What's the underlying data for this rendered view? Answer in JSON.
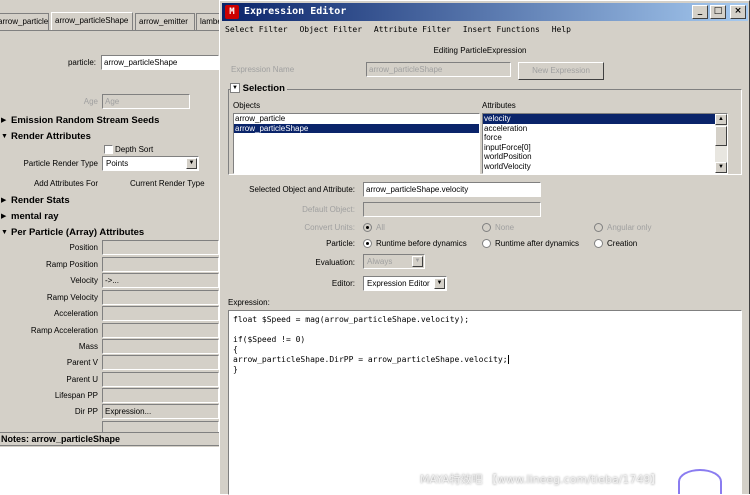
{
  "attr_editor": {
    "tabs": [
      "arrow_particle",
      "arrow_particleShape",
      "arrow_emitter",
      "lambe"
    ],
    "particle_label": "particle:",
    "particle_value": "arrow_particleShape",
    "age_label": "Age",
    "age_value": "Age",
    "sections": {
      "emission": "Emission Random Stream Seeds",
      "render": "Render Attributes",
      "render_stats": "Render Stats",
      "mental_ray": "mental ray",
      "per_particle": "Per Particle (Array) Attributes"
    },
    "depth_sort": "Depth Sort",
    "particle_render_type_label": "Particle Render Type",
    "particle_render_type_value": "Points",
    "add_attributes_label": "Add Attributes For",
    "current_render_type": "Current Render Type",
    "per_particle_attrs": [
      {
        "label": "Position",
        "value": ""
      },
      {
        "label": "Ramp Position",
        "value": ""
      },
      {
        "label": "Velocity",
        "value": "->..."
      },
      {
        "label": "Ramp Velocity",
        "value": ""
      },
      {
        "label": "Acceleration",
        "value": ""
      },
      {
        "label": "Ramp Acceleration",
        "value": ""
      },
      {
        "label": "Mass",
        "value": ""
      },
      {
        "label": "Parent V",
        "value": ""
      },
      {
        "label": "Parent U",
        "value": ""
      },
      {
        "label": "Lifespan PP",
        "value": ""
      },
      {
        "label": "Dir PP",
        "value": "Expression..."
      }
    ],
    "notes": "Notes:  arrow_particleShape"
  },
  "window": {
    "title": "Expression Editor",
    "title_buttons": [
      "_",
      "□",
      "×"
    ],
    "menu": [
      "Select Filter",
      "Object Filter",
      "Attribute Filter",
      "Insert Functions",
      "Help"
    ],
    "editing": "Editing ParticleExpression",
    "expression_name_label": "Expression Name",
    "expression_name_value": "arrow_particleShape",
    "new_expression": "New Expression",
    "selection_title": "Selection",
    "objects_label": "Objects",
    "objects": [
      "arrow_particle",
      "arrow_particleShape"
    ],
    "attributes_label": "Attributes",
    "attributes": [
      "velocity",
      "acceleration",
      "force",
      "inputForce[0]",
      "worldPosition",
      "worldVelocity"
    ],
    "selected_obj_label": "Selected Object and Attribute:",
    "selected_obj_value": "arrow_particleShape.velocity",
    "default_object_label": "Default Object:",
    "default_object_value": "",
    "convert_units_label": "Convert Units:",
    "convert_units": [
      "All",
      "None",
      "Angular only"
    ],
    "particle_label": "Particle:",
    "particle_options": [
      "Runtime before dynamics",
      "Runtime after dynamics",
      "Creation"
    ],
    "evaluation_label": "Evaluation:",
    "evaluation_value": "Always",
    "editor_label": "Editor:",
    "editor_value": "Expression Editor",
    "expression_label": "Expression:",
    "code": [
      "float $Speed = mag(arrow_particleShape.velocity);",
      "",
      "if($Speed != 0)",
      "{",
      "arrow_particleShape.DirPP = arrow_particleShape.velocity;",
      "}"
    ]
  },
  "watermark": "MAYA特效吧 【www.lineeg.com/tieba/1749】",
  "colors": {
    "titlebar": "#0a246a",
    "selection": "#0a246a",
    "panel": "#d4d0c8"
  }
}
